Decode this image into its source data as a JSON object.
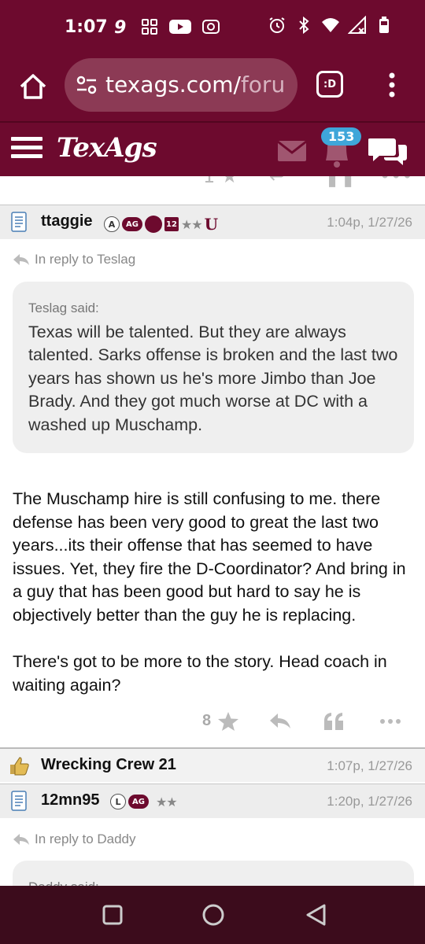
{
  "status_bar": {
    "time": "1:07",
    "left_icons": [
      "nine-app-icon",
      "grid-app-icon",
      "youtube-icon",
      "radio-icon"
    ],
    "right_icons": [
      "alarm-icon",
      "bluetooth-icon",
      "wifi-icon",
      "signal-icon",
      "battery-icon"
    ]
  },
  "browser": {
    "url_main": "texags.com/",
    "url_faded": "foru",
    "tab_label": ":D"
  },
  "site": {
    "logo": "TexAgs",
    "notification_count": "153"
  },
  "posts": [
    {
      "username": "ttaggie",
      "badge_letter": "A",
      "badge_ag": "AG",
      "badge_12": "12",
      "badge_stars": "★★",
      "badge_u": "U",
      "time": "1:04p, 1/27/26",
      "reply_to": "In reply to Teslag",
      "quote_author": "Teslag said:",
      "quote_text": "Texas will be talented. But they are always talented. Sarks offense is broken and the last two years has shown us he's more Jimbo than Joe Brady. And they got much worse at DC with a washed up Muschamp.",
      "body_p1": "The Muschamp hire is still confusing to me. there defense has been very good to great the last two years...its their offense that has seemed to have issues. Yet, they fire the D-Coordinator? And bring in a guy that has been good but hard to say he is objectively better than the guy he is replacing.",
      "body_p2": "There's got to be more to the story. Head coach in waiting again?",
      "star_count": "8"
    },
    {
      "username": "Wrecking Crew 21",
      "time": "1:07p, 1/27/26"
    },
    {
      "username": "12mn95",
      "badge_letter": "L",
      "badge_ag": "AG",
      "badge_stars": "★★",
      "time": "1:20p, 1/27/26",
      "reply_to": "In reply to Daddy",
      "quote_author": "Daddy said:"
    }
  ],
  "colors": {
    "maroon": "#6d0a2e",
    "badge_blue": "#3fa6d9"
  }
}
